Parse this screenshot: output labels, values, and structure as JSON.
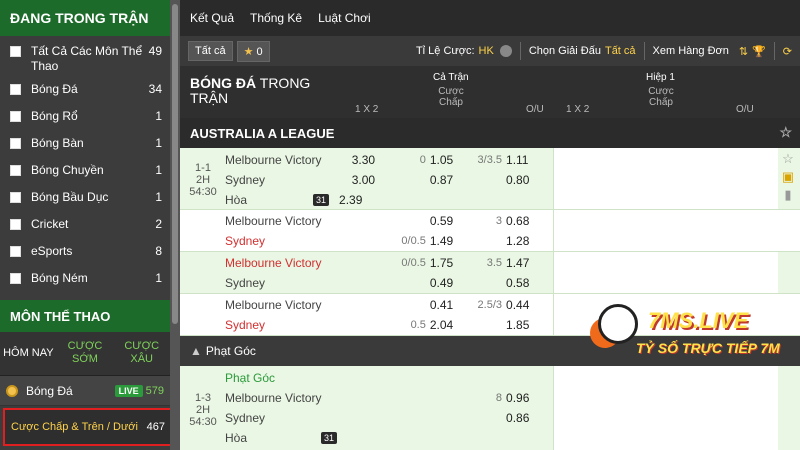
{
  "sidebar": {
    "heading": "ĐANG TRONG TRẬN",
    "sports": [
      {
        "label": "Tất Cả Các Môn Thể Thao",
        "count": "49"
      },
      {
        "label": "Bóng Đá",
        "count": "34"
      },
      {
        "label": "Bóng Rổ",
        "count": "1"
      },
      {
        "label": "Bóng Bàn",
        "count": "1"
      },
      {
        "label": "Bóng Chuyền",
        "count": "1"
      },
      {
        "label": "Bóng Bầu Dục",
        "count": "1"
      },
      {
        "label": "Cricket",
        "count": "2"
      },
      {
        "label": "eSports",
        "count": "8"
      },
      {
        "label": "Bóng Ném",
        "count": "1"
      }
    ],
    "heading2": "MÔN THỂ THAO",
    "tabs": [
      "HÔM NAY",
      "CƯỢC SỚM",
      "CƯỢC XÂU"
    ],
    "football": {
      "label": "Bóng Đá",
      "live": "LIVE",
      "count": "579"
    },
    "selected": {
      "label": "Cược Chấp & Trên / Dưới",
      "count": "467"
    }
  },
  "topnav": [
    "Kết Quả",
    "Thống Kê",
    "Luật Chơi"
  ],
  "toolbar": {
    "all": "Tất cả",
    "fav_count": "0",
    "odds_label": "Tỉ Lệ Cược:",
    "odds_value": "HK",
    "league_label": "Chọn Giải Đấu",
    "league_value": "Tất cả",
    "view_label": "Xem Hàng Đơn"
  },
  "header": {
    "title_bold": "BÓNG ĐÁ",
    "title_rest": " TRONG",
    "title_line2": "TRẬN",
    "full": "Cả Trận",
    "half": "Hiệp 1",
    "col_1x2": "1 X 2",
    "col_hcp": "Cược Chấp",
    "col_ou": "O/U"
  },
  "league": "AUSTRALIA A LEAGUE",
  "match": {
    "score": "1-1",
    "period": "2H",
    "clock": "54:30",
    "home": "Melbourne Victory",
    "away": "Sydney",
    "draw": "Hòa",
    "x_home": "3.30",
    "x_away": "3.00",
    "x_draw": "2.39",
    "hcp_line": "0",
    "hcp_home": "1.05",
    "hcp_away": "0.87",
    "ou_line": "3/3.5",
    "ou_over": "1.11",
    "ou_under": "0.80",
    "badge": "31"
  },
  "alt_lines": [
    {
      "home": "Melbourne Victory",
      "away": "Sydney",
      "home_red": false,
      "away_red": true,
      "hcp_home_line": "",
      "hcp_away_line": "0/0.5",
      "hcp_home": "0.59",
      "hcp_away": "1.49",
      "ou_line": "3",
      "ou_over": "0.68",
      "ou_under": "1.28"
    },
    {
      "home": "Melbourne Victory",
      "away": "Sydney",
      "home_red": true,
      "away_red": false,
      "hcp_home_line": "0/0.5",
      "hcp_away_line": "",
      "hcp_home": "1.75",
      "hcp_away": "0.49",
      "ou_line": "3.5",
      "ou_over": "1.47",
      "ou_under": "0.58"
    },
    {
      "home": "Melbourne Victory",
      "away": "Sydney",
      "home_red": false,
      "away_red": true,
      "hcp_home_line": "",
      "hcp_away_line": "0.5",
      "hcp_home": "0.41",
      "hcp_away": "2.04",
      "ou_line": "2.5/3",
      "ou_over": "0.44",
      "ou_under": "1.85"
    }
  ],
  "corners": {
    "heading": "Phạt Góc",
    "label": "Phạt Góc",
    "score": "1-3",
    "period": "2H",
    "clock": "54:30",
    "home": "Melbourne Victory",
    "away": "Sydney",
    "draw": "Hòa",
    "ou_line": "8",
    "ou_over": "0.96",
    "ou_under": "0.86",
    "badge": "31"
  },
  "logo": {
    "brand": "7MS.LIVE",
    "tagline": "TỶ SỐ TRỰC TIẾP 7M"
  }
}
